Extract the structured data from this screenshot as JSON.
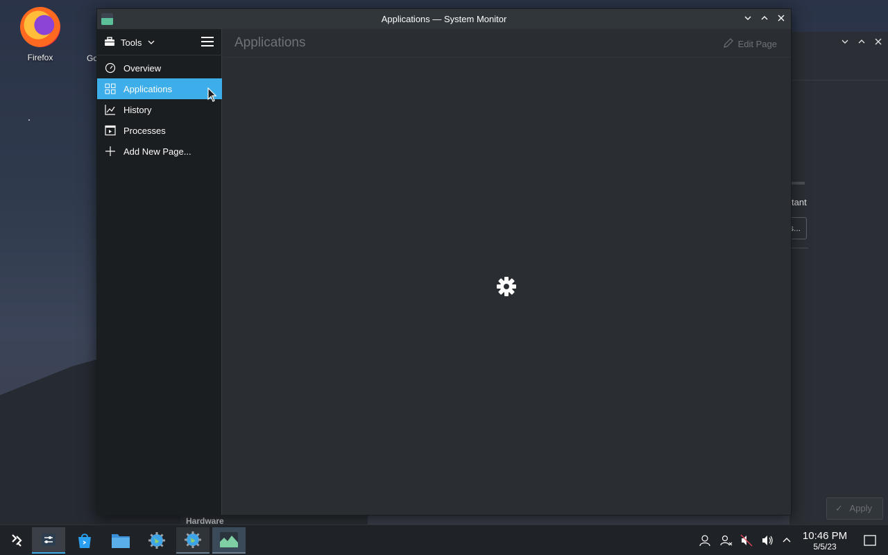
{
  "desktop": {
    "icons": [
      {
        "label": "Firefox"
      }
    ],
    "partial_label": "Go"
  },
  "background_window": {
    "partial_text": "tant",
    "partial_button": "s...",
    "apply_label": "Apply",
    "hardware_label": "Hardware"
  },
  "window": {
    "title": "Applications — System Monitor",
    "tools_label": "Tools",
    "page_title": "Applications",
    "edit_page_label": "Edit Page",
    "nav": [
      {
        "label": "Overview",
        "icon": "speedometer-icon"
      },
      {
        "label": "Applications",
        "icon": "grid-icon",
        "active": true
      },
      {
        "label": "History",
        "icon": "chart-icon"
      },
      {
        "label": "Processes",
        "icon": "process-window-icon"
      },
      {
        "label": "Add New Page...",
        "icon": "plus-icon"
      }
    ]
  },
  "taskbar": {
    "apps": [
      "app-launcher-icon",
      "settings-icon",
      "discover-icon",
      "file-manager-icon",
      "browser-icon",
      "browser-icon-2",
      "system-monitor-icon"
    ],
    "clock": {
      "time": "10:46 PM",
      "date": "5/5/23"
    }
  },
  "colors": {
    "accent": "#3daee9",
    "window_bg": "#2a2e32",
    "sidebar_bg": "#1b1e20"
  }
}
